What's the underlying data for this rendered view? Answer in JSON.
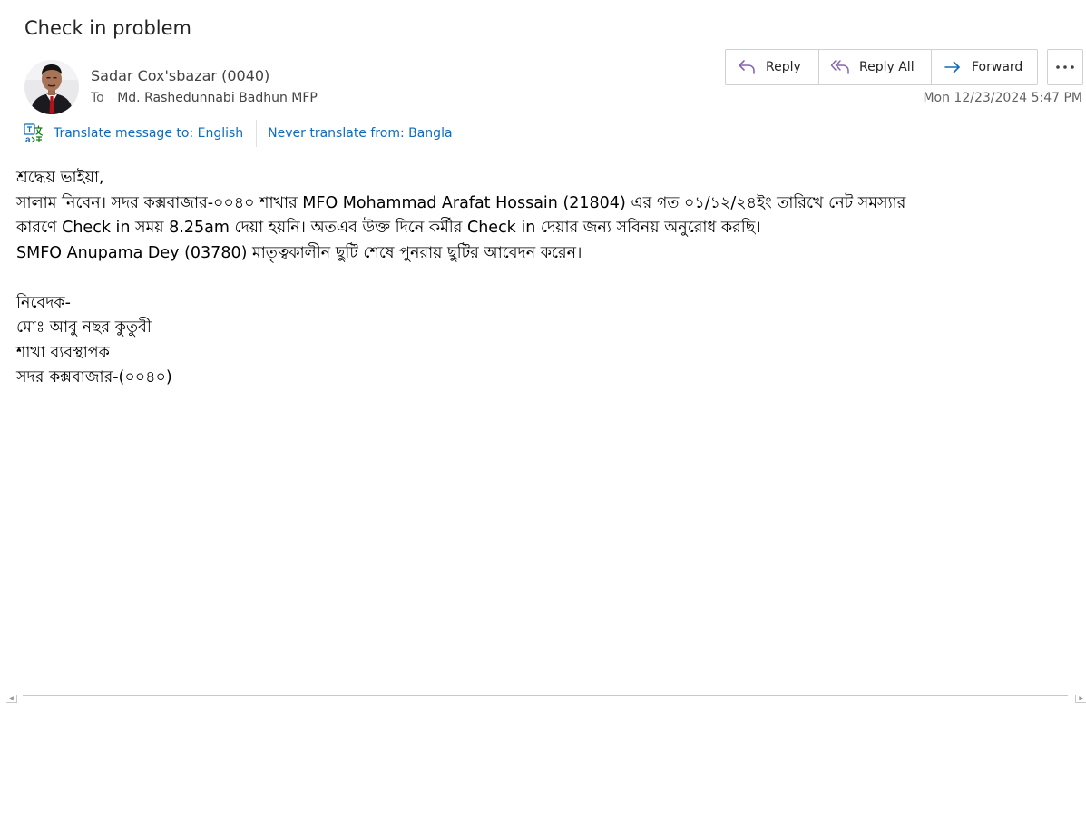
{
  "message": {
    "subject": "Check in problem",
    "sender": "Sadar Cox'sbazar (0040)",
    "to_label": "To",
    "recipient": "Md. Rashedunnabi Badhun MFP",
    "timestamp": "Mon 12/23/2024 5:47 PM"
  },
  "actions": {
    "reply": "Reply",
    "reply_all": "Reply All",
    "forward": "Forward"
  },
  "translate": {
    "translate_link": "Translate message to: English",
    "never_link": "Never translate from: Bangla"
  },
  "body": {
    "line1": "শ্রদ্ধেয় ভাইয়া,",
    "line2": "সালাম নিবেন। সদর কক্সবাজার-০০৪০ শাখার  MFO Mohammad  Arafat  Hossain (21804) এর গত ০১/১২/২৪ইং তারিখে নেট সমস্যার",
    "line3": "কারণে Check in সময় 8.25am দেয়া হয়নি। অতএব উক্ত দিনে কর্মীর  Check in দেয়ার জন্য সবিনয় অনুরোধ করছি।",
    "line4": "SMFO Anupama  Dey (03780) মাতৃত্বকালীন ছুটি শেষে পুনরায় ছুটির আবেদন করেন।",
    "line5": "নিবেদক-",
    "line6": "মোঃ আবু নছর কুতুবী",
    "line7": "শাখা ব্যবস্থাপক",
    "line8": "সদর কক্সবাজার-(০০৪০)"
  },
  "colors": {
    "link": "#0f6cbd",
    "reply_all_icon": "#8764b8",
    "forward_icon": "#0f6cbd"
  },
  "icons": {
    "reply": "reply-arrow-icon",
    "reply_all": "reply-all-arrow-icon",
    "forward": "forward-arrow-icon",
    "more": "more-horizontal-icon",
    "translate": "translate-icon"
  }
}
